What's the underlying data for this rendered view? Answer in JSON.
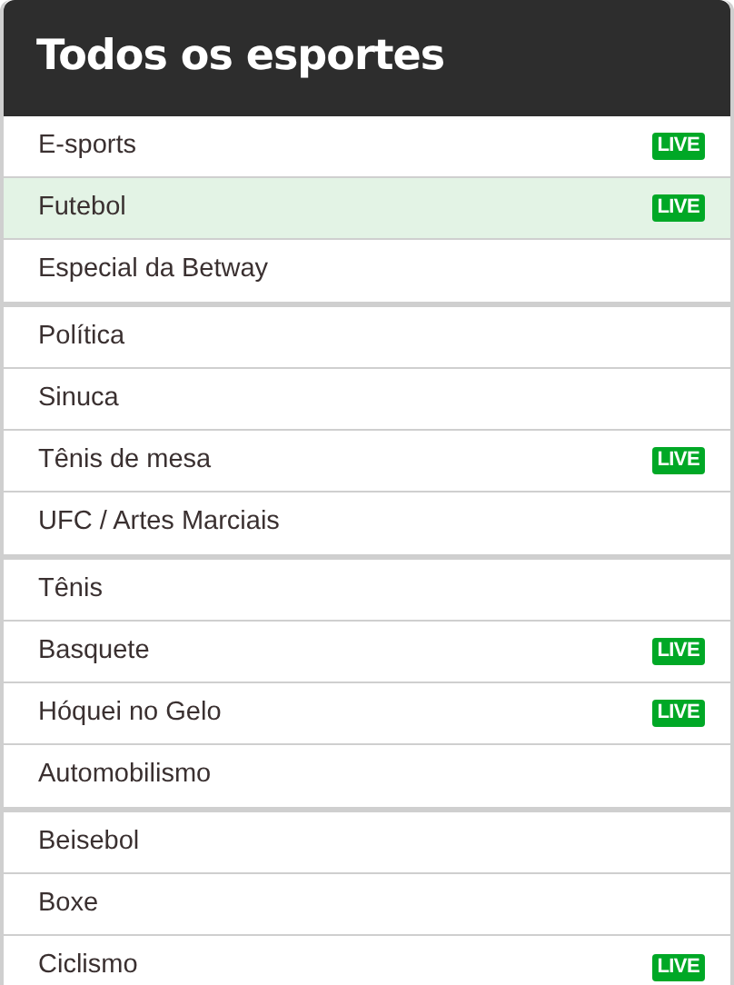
{
  "title": "Todos os esportes",
  "groups": [
    {
      "items": [
        {
          "label": "E-sports",
          "live": "LIVE",
          "selected": false
        },
        {
          "label": "Futebol",
          "live": "LIVE",
          "selected": true
        },
        {
          "label": "Especial da Betway",
          "selected": false
        }
      ]
    },
    {
      "items": [
        {
          "label": "Política",
          "selected": false
        },
        {
          "label": "Sinuca",
          "selected": false
        },
        {
          "label": "Tênis de mesa",
          "live": "LIVE",
          "selected": false
        },
        {
          "label": "UFC / Artes Marciais",
          "selected": false
        }
      ]
    },
    {
      "items": [
        {
          "label": "Tênis",
          "selected": false
        },
        {
          "label": "Basquete",
          "live": "LIVE",
          "selected": false
        },
        {
          "label": "Hóquei no Gelo",
          "live": "LIVE",
          "selected": false
        },
        {
          "label": "Automobilismo",
          "selected": false
        }
      ]
    },
    {
      "items": [
        {
          "label": "Beisebol",
          "selected": false
        },
        {
          "label": "Boxe",
          "selected": false
        },
        {
          "label": "Ciclismo",
          "live": "LIVE",
          "selected": false
        }
      ]
    }
  ]
}
